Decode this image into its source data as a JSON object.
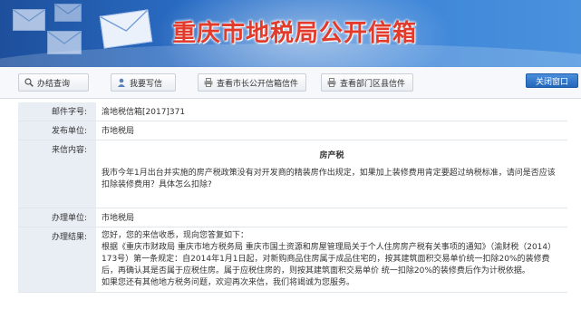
{
  "header": {
    "title": "重庆市地税局公开信箱"
  },
  "toolbar": {
    "query": "办结查询",
    "write": "我要写信",
    "mayor": "查看市长公开信箱信件",
    "dept": "查看部门区县信件",
    "close": "关闭窗口"
  },
  "detail": {
    "letter_no_label": "邮件字号:",
    "letter_no": "渝地税信箱[2017]371",
    "publisher_label": "发布单位:",
    "publisher": "市地税局",
    "content_label": "来信内容:",
    "subject": "房产税",
    "content": "我市今年1月出台并实施的房产税政策没有对开发商的精装房作出规定，如果加上装修费用肯定要超过纳税标准，请问是否应该扣除装修费用？具体怎么扣除?",
    "handler_label": "办理单位:",
    "handler": "市地税局",
    "result_label": "办理结果:",
    "result_1": "您好，您的来信收悉，现向您答复如下：",
    "result_2": "根据《重庆市财政局 重庆市地方税务局 重庆市国土资源和房屋管理局关于个人住房房产税有关事项的通知》（渝财税（2014）173号）第一条规定：自2014年1月1日起，对新购商品住房属于成品住宅的，按其建筑面积交易单价统一扣除20%的装修费后，再确认其是否属于应税住房。属于应税住房的，则按其建筑面积交易单价 统一扣除20%的装修费后作为计税依据。",
    "result_3": "如果您还有其他地方税务问题，欢迎再次来信，我们将竭诚为您服务。"
  },
  "colors": {
    "banner": "#2b6fc7",
    "title": "#e23b2c",
    "label_bg": "#e9eef5",
    "close_btn": "#2466b8"
  },
  "icons": [
    "magnifier-icon",
    "person-icon",
    "printer-icon",
    "printer-icon",
    "envelope-icon"
  ]
}
